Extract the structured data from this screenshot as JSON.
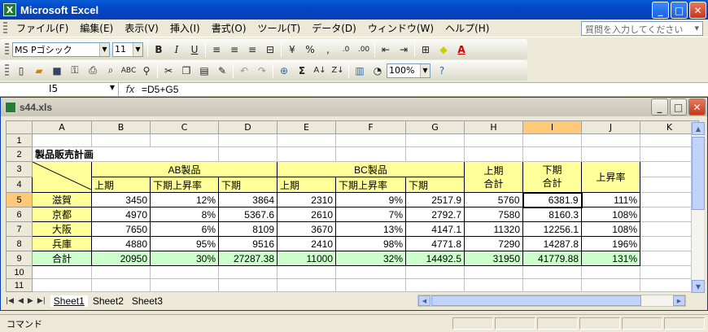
{
  "app": {
    "title": "Microsoft Excel",
    "icon_letter": "X"
  },
  "menu": [
    "ファイル(F)",
    "編集(E)",
    "表示(V)",
    "挿入(I)",
    "書式(O)",
    "ツール(T)",
    "データ(D)",
    "ウィンドウ(W)",
    "ヘルプ(H)"
  ],
  "help_placeholder": "質問を入力してください",
  "format_toolbar": {
    "font": "MS Pゴシック",
    "size": "11"
  },
  "standard_toolbar": {
    "zoom": "100%"
  },
  "formula": {
    "cell": "I5",
    "fx": "fx",
    "value": "=D5+G5"
  },
  "workbook": {
    "filename": "s44.xls"
  },
  "columns": [
    "A",
    "B",
    "C",
    "D",
    "E",
    "F",
    "G",
    "H",
    "I",
    "J",
    "K"
  ],
  "rows": [
    "1",
    "2",
    "3",
    "4",
    "5",
    "6",
    "7",
    "8",
    "9",
    "10",
    "11"
  ],
  "sheet": {
    "title": "製品販売計画",
    "ab_header": "AB製品",
    "bc_header": "BC製品",
    "h_top": "上期",
    "h_bottom": "合計",
    "i_top": "下期",
    "i_bottom": "合計",
    "j_header": "上昇率",
    "sub": [
      "上期",
      "下期上昇率",
      "下期",
      "上期",
      "下期上昇率",
      "下期"
    ],
    "data": [
      [
        "滋賀",
        "3450",
        "12%",
        "3864",
        "2310",
        "9%",
        "2517.9",
        "5760",
        "6381.9",
        "111%"
      ],
      [
        "京都",
        "4970",
        "8%",
        "5367.6",
        "2610",
        "7%",
        "2792.7",
        "7580",
        "8160.3",
        "108%"
      ],
      [
        "大阪",
        "7650",
        "6%",
        "8109",
        "3670",
        "13%",
        "4147.1",
        "11320",
        "12256.1",
        "108%"
      ],
      [
        "兵庫",
        "4880",
        "95%",
        "9516",
        "2410",
        "98%",
        "4771.8",
        "7290",
        "14287.8",
        "196%"
      ]
    ],
    "total": [
      "合計",
      "20950",
      "30%",
      "27287.38",
      "11000",
      "32%",
      "14492.5",
      "31950",
      "41779.88",
      "131%"
    ]
  },
  "tabs": [
    "Sheet1",
    "Sheet2",
    "Sheet3"
  ],
  "status": "コマンド"
}
